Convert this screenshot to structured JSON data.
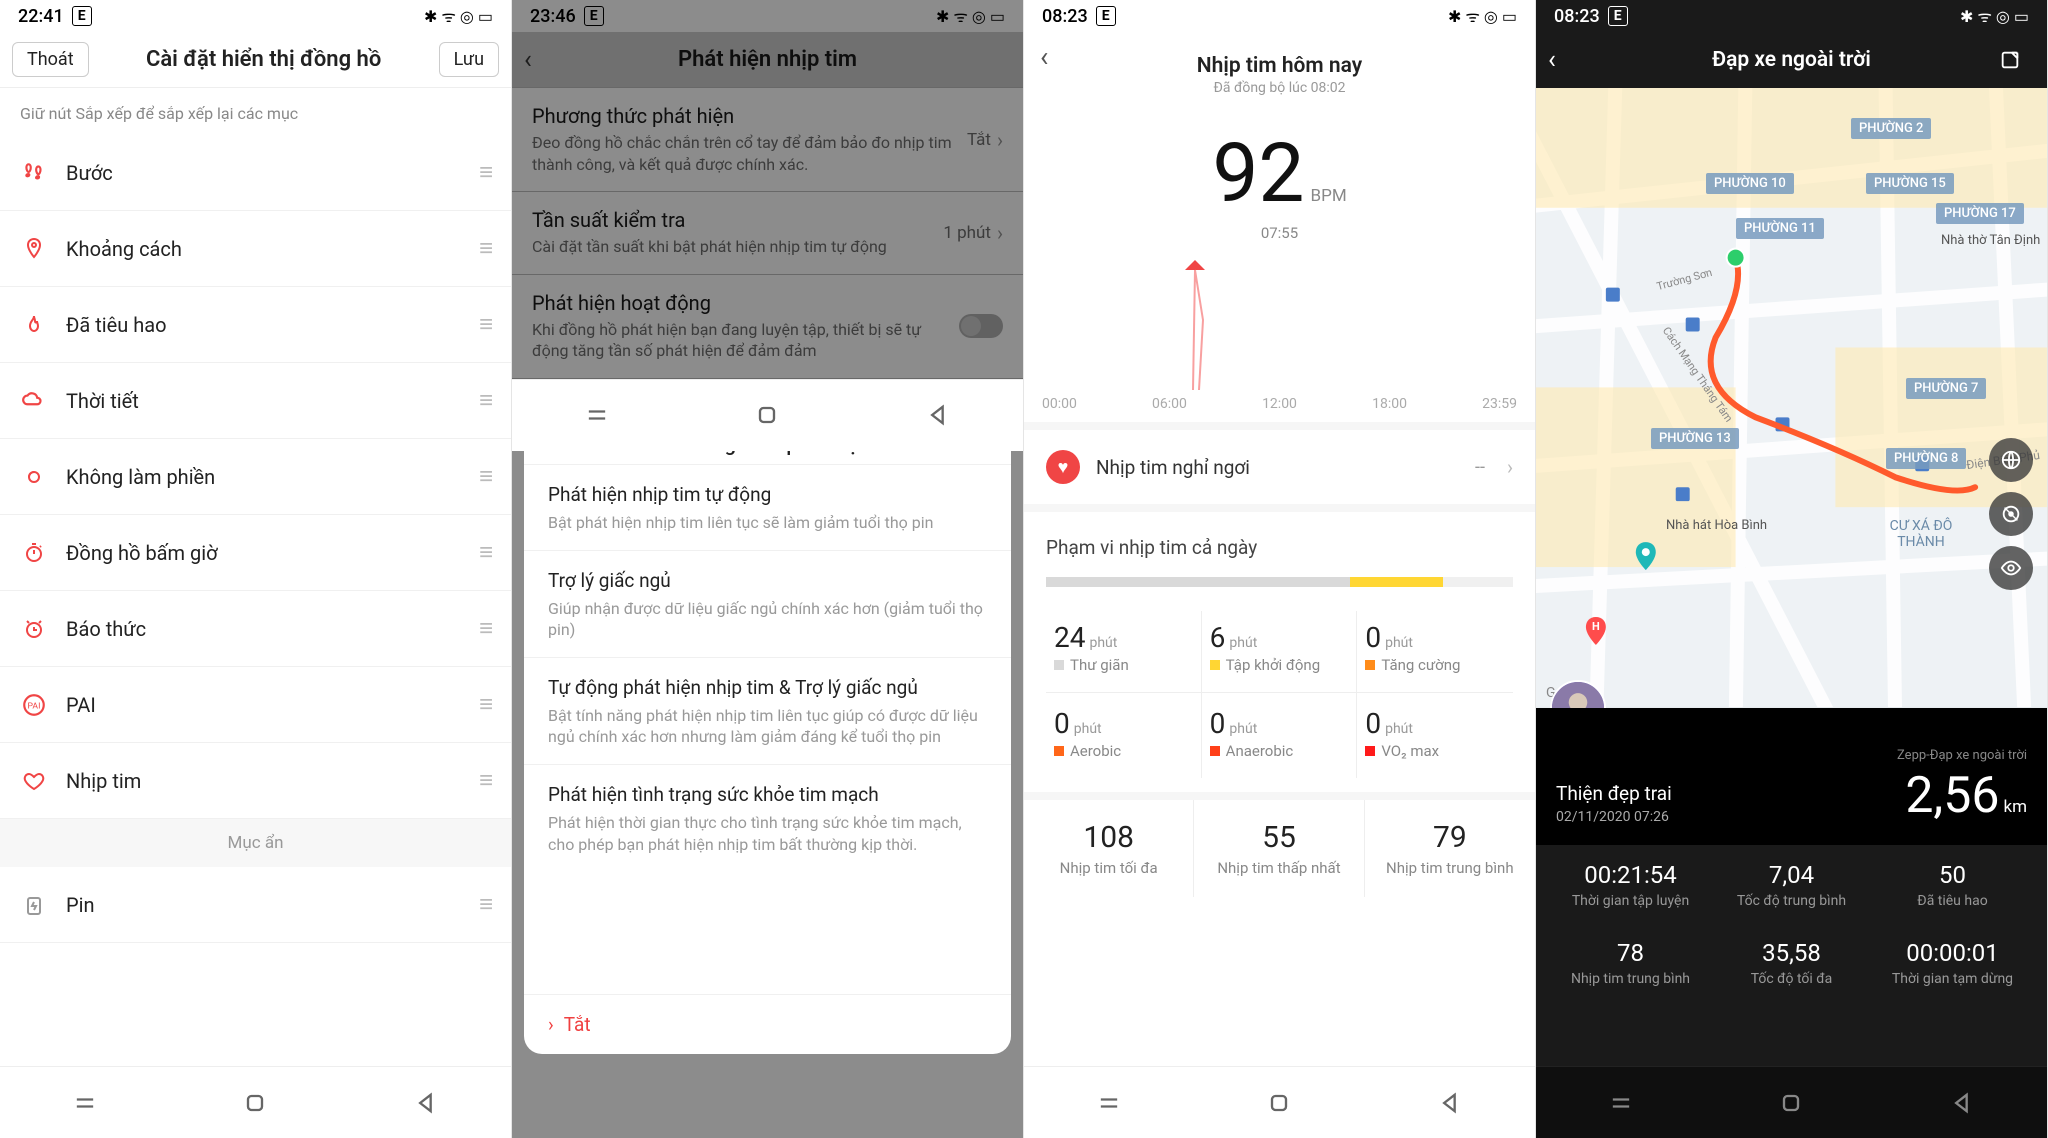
{
  "status": {
    "s1_time": "22:41",
    "s2_time": "23:46",
    "s3_time": "08:23",
    "s4_time": "08:23",
    "icons": "✱ ᯤ ⦿ ▭"
  },
  "s1": {
    "exit": "Thoát",
    "title": "Cài đặt hiển thị đồng hồ",
    "save": "Lưu",
    "hint": "Giữ nút Sắp xếp để sắp xếp lại các mục",
    "items": [
      {
        "label": "Bước",
        "icon": "steps"
      },
      {
        "label": "Khoảng cách",
        "icon": "pin"
      },
      {
        "label": "Đã tiêu hao",
        "icon": "fire"
      },
      {
        "label": "Thời tiết",
        "icon": "cloud"
      },
      {
        "label": "Không làm phiền",
        "icon": "dnd"
      },
      {
        "label": "Đồng hồ bấm giờ",
        "icon": "stopwatch"
      },
      {
        "label": "Báo thức",
        "icon": "alarm"
      },
      {
        "label": "PAI",
        "icon": "pai"
      },
      {
        "label": "Nhịp tim",
        "icon": "heart"
      }
    ],
    "hidden_section": "Mục ẩn",
    "pin": "Pin"
  },
  "s2": {
    "title": "Phát hiện nhịp tim",
    "bg": [
      {
        "t": "Phương thức phát hiện",
        "s": "Đeo đồng hồ chắc chắn trên cổ tay để đảm bảo đo nhịp tim thành công, và kết quả được chính xác.",
        "v": "Tắt",
        "chev": true
      },
      {
        "t": "Tần suất kiểm tra",
        "s": "Cài đặt tần suất khi bật phát hiện nhịp tim tự động",
        "v": "1 phút",
        "chev": true
      },
      {
        "t": "Phát hiện hoạt động",
        "s": "Khi đồng hồ phát hiện bạn đang luyện tập, thiết bị sẽ tự động tăng tần số phát hiện để đảm đảm",
        "toggle": true
      }
    ],
    "sheet_title": "Phương thức phát hiện",
    "sheet": [
      {
        "t": "Phát hiện nhịp tim tự động",
        "s": "Bật phát hiện nhịp tim liên tục sẽ làm giảm tuổi thọ pin"
      },
      {
        "t": "Trợ lý giấc ngủ",
        "s": "Giúp nhận được dữ liệu giấc ngủ chính xác hơn (giảm tuổi thọ pin)"
      },
      {
        "t": "Tự động phát hiện nhịp tim & Trợ lý giấc ngủ",
        "s": "Bật tính năng phát hiện nhịp tim liên tục giúp có được dữ liệu ngủ chính xác hơn nhưng làm giảm đáng kể tuổi thọ pin"
      },
      {
        "t": "Phát hiện tình trạng sức khỏe tim mạch",
        "s": "Phát hiện thời gian thực cho tình trạng sức khỏe tim mạch, cho phép bạn phát hiện nhịp tim bất thường kịp thời."
      }
    ],
    "off": "Tắt"
  },
  "s3": {
    "title": "Nhịp tim hôm nay",
    "sync": "Đã đồng bộ lúc 08:02",
    "bpm_value": "92",
    "bpm_unit": "BPM",
    "bpm_time": "07:55",
    "axis": [
      "00:00",
      "06:00",
      "12:00",
      "18:00",
      "23:59"
    ],
    "rest_label": "Nhịp tim nghỉ ngơi",
    "rest_value": "--",
    "range_title": "Phạm vi nhịp tim cả ngày",
    "zones": [
      {
        "n": "24",
        "u": "phút",
        "lab": "Thư giãn",
        "color": "#d9d9d9"
      },
      {
        "n": "6",
        "u": "phút",
        "lab": "Tập khởi động",
        "color": "#ffd633"
      },
      {
        "n": "0",
        "u": "phút",
        "lab": "Tăng cường",
        "color": "#ff8c1a"
      },
      {
        "n": "0",
        "u": "phút",
        "lab": "Aerobic",
        "color": "#ff6619"
      },
      {
        "n": "0",
        "u": "phút",
        "lab": "Anaerobic",
        "color": "#ff4019"
      },
      {
        "n": "0",
        "u": "phút",
        "lab": "VO₂ max",
        "color": "#ff1a1a"
      }
    ],
    "stats": [
      {
        "n": "108",
        "lab": "Nhịp tim tối đa"
      },
      {
        "n": "55",
        "lab": "Nhịp tim thấp nhất"
      },
      {
        "n": "79",
        "lab": "Nhịp tim trung bình"
      }
    ]
  },
  "s4": {
    "title": "Đạp xe ngoài trời",
    "map_labels": [
      "PHƯỜNG 2",
      "PHƯỜNG 10",
      "PHƯỜNG 15",
      "PHƯỜNG 11",
      "PHƯỜNG 17",
      "PHƯỜNG 7",
      "PHƯỜNG 13",
      "PHƯỜNG 8",
      "CƯ XÁ ĐÔ THÀNH"
    ],
    "map_pois": [
      "Nhà thờ Tân Định",
      "Nhà hát Hòa Bình",
      "Điện Biên Phủ",
      "Cách Mạng Tháng Tám",
      "Trường Sơn"
    ],
    "source": "Zepp-Đạp xe ngoài trời",
    "user": "Thiện đẹp trai",
    "date": "02/11/2020 07:26",
    "distance": "2,56",
    "distance_unit": "km",
    "stats": [
      {
        "n": "00:21:54",
        "lab": "Thời gian tập luyện"
      },
      {
        "n": "7,04",
        "lab": "Tốc độ trung bình"
      },
      {
        "n": "50",
        "lab": "Đã tiêu hao"
      },
      {
        "n": "78",
        "lab": "Nhịp tim trung bình"
      },
      {
        "n": "35,58",
        "lab": "Tốc độ tối đa"
      },
      {
        "n": "00:00:01",
        "lab": "Thời gian tạm dừng"
      }
    ]
  }
}
